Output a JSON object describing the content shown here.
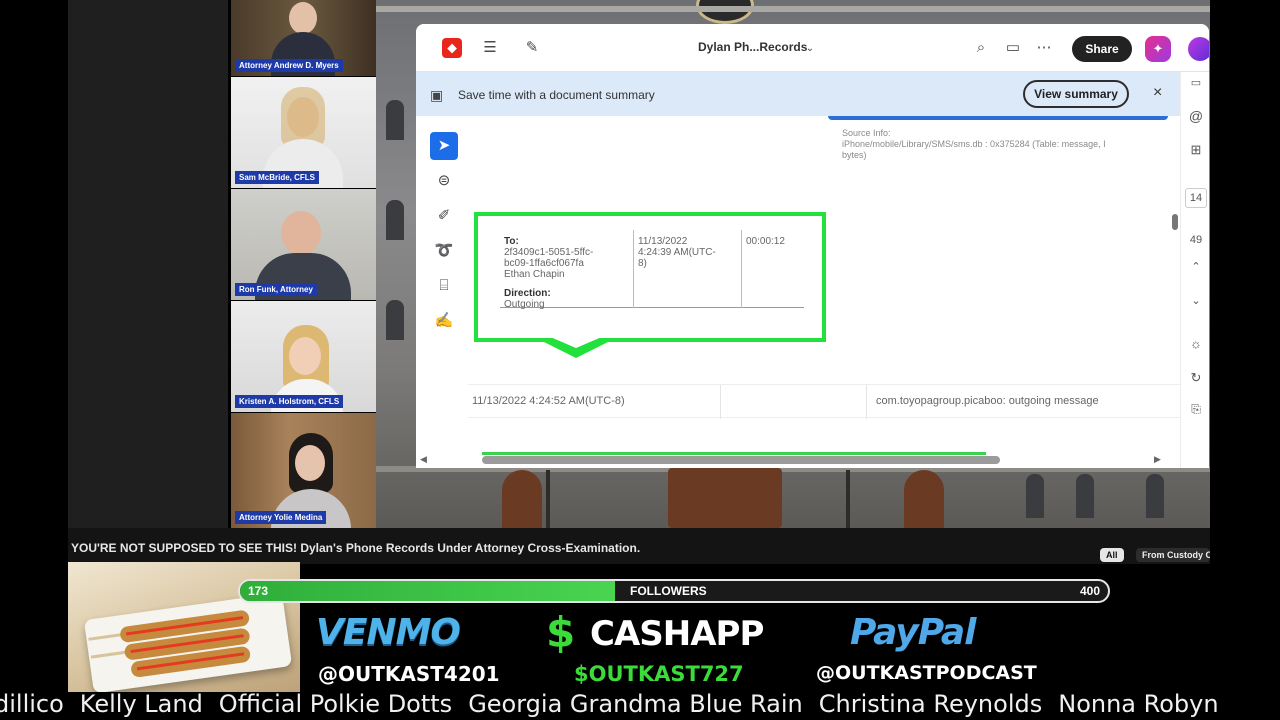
{
  "participants": [
    {
      "name": "Attorney Andrew D. Myers"
    },
    {
      "name": "Sam McBride, CFLS"
    },
    {
      "name": "Ron Funk, Attorney"
    },
    {
      "name": "Kristen A. Holstrom, CFLS"
    },
    {
      "name": "Attorney Yolie Medina"
    }
  ],
  "viewer": {
    "doc_title": "Dylan Ph...Records",
    "share_label": "Share",
    "summary_text": "Save time with a document summary",
    "summary_button": "View summary",
    "close_glyph": "×",
    "tools": [
      "select-icon",
      "comment-icon",
      "pen-icon",
      "lasso-icon",
      "text-select-icon",
      "sign-icon"
    ],
    "page_number": "14",
    "page_total": "49",
    "source_info_line1": "Source Info:",
    "source_info_line2": "iPhone/mobile/Library/SMS/sms.db : 0x375284 (Table: message, I",
    "source_info_line3": "bytes)",
    "record": {
      "to_label": "To:",
      "to_value_1": "2f3409c1-5051-5ffc-",
      "to_value_2": "bc09-1ffa6cf067fa",
      "to_value_3": "Ethan Chapin",
      "direction_label": "Direction:",
      "direction_value": "Outgoing",
      "timestamp_1": "11/13/2022",
      "timestamp_2": "4:24:39 AM(UTC-",
      "timestamp_3": "8)",
      "duration": "00:00:12"
    },
    "row2": {
      "timestamp": "11/13/2022 4:24:52 AM(UTC-8)",
      "source": "com.toyopagroup.picaboo: outgoing message"
    },
    "accent_green": "#22e13c"
  },
  "caption": "YOU'RE NOT SUPPOSED TO SEE THIS! Dylan's Phone Records Under Attorney Cross-Examination.",
  "chips": {
    "all": "All",
    "custody": "From Custody C"
  },
  "followers": {
    "current": "173",
    "label": "FOLLOWERS",
    "goal": "400",
    "progress_fraction": 0.4325
  },
  "payments": {
    "venmo_name": "VENMO",
    "venmo_handle": "@OUTKAST4201",
    "cashapp_symbol": "$",
    "cashapp_name": "CASHAPP",
    "cashapp_handle": "$OUTKAST727",
    "paypal_name": "PayPal",
    "paypal_handle": "@OUTKASTPODCAST"
  },
  "ticker": [
    "dillico",
    "Kelly Land",
    "Official Polkie Dotts",
    "Georgia Grandma Blue Rain",
    "Christina Reynolds",
    "Nonna Robyn"
  ]
}
